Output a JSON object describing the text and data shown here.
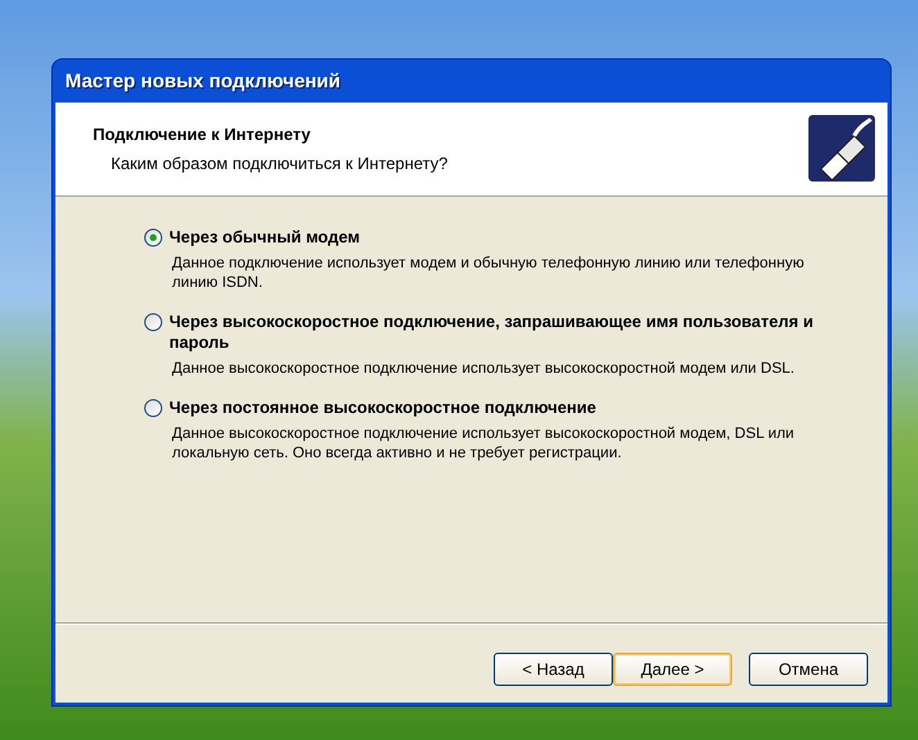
{
  "window": {
    "title": "Мастер новых подключений"
  },
  "header": {
    "title": "Подключение к Интернету",
    "subtitle": "Каким образом подключиться к Интернету?"
  },
  "options": [
    {
      "label": "Через обычный модем",
      "description": "Данное подключение использует модем и обычную телефонную линию или телефонную линию ISDN.",
      "selected": true
    },
    {
      "label": "Через высокоскоростное подключение, запрашивающее имя пользователя и пароль",
      "description": "Данное высокоскоростное подключение использует высокоскоростной модем или DSL.",
      "selected": false
    },
    {
      "label": "Через постоянное высокоскоростное подключение",
      "description": "Данное высокоскоростное подключение использует высокоскоростной модем, DSL или локальную сеть. Оно всегда активно и не требует регистрации.",
      "selected": false
    }
  ],
  "buttons": [
    {
      "label": "< Назад",
      "default": false
    },
    {
      "label": "Далее >",
      "default": true
    },
    {
      "label": "Отмена",
      "default": false
    }
  ]
}
